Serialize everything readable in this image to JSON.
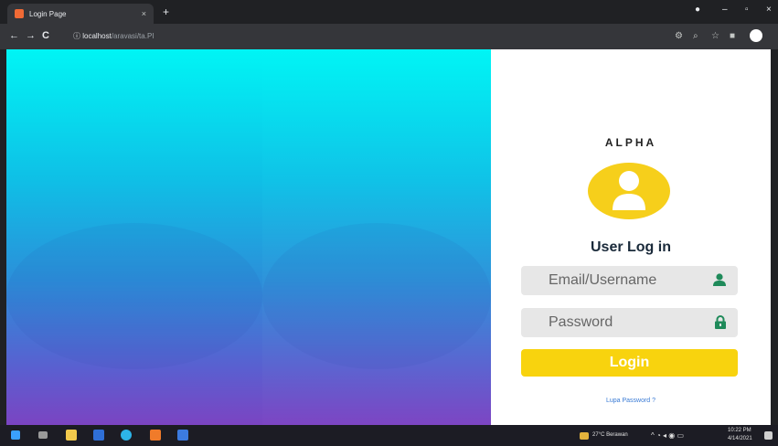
{
  "browser": {
    "tab_title": "Login Page",
    "tab_close": "×",
    "new_tab": "+",
    "url_host": "localhost",
    "url_path": "/aravasi/ta.PI",
    "back": "←",
    "forward": "→",
    "reload": "C",
    "info": "ⓘ"
  },
  "login": {
    "brand": "ALPHA",
    "title": "User Log in",
    "email_placeholder": "Email/Username",
    "password_placeholder": "Password",
    "login_button": "Login",
    "forgot_link": "Lupa Password ?"
  },
  "taskbar": {
    "weather": "27°C Berawan",
    "time": "10:22 PM",
    "date": "4/14/2021"
  },
  "colors": {
    "accent_yellow": "#f8d30e",
    "icon_green": "#1f8a5a",
    "gradient_top": "#00f5f5",
    "gradient_bottom": "#7b44c2"
  }
}
